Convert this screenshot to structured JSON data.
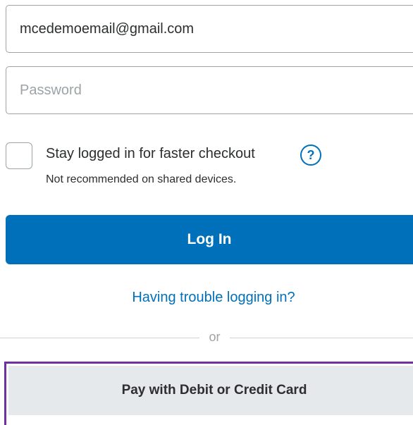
{
  "login_form": {
    "email_value": "mcedemoemail@gmail.com",
    "password_placeholder": "Password",
    "stay_logged_in_label": "Stay logged in for faster checkout",
    "stay_logged_in_checked": false,
    "help_icon_glyph": "?",
    "stay_logged_in_note": "Not recommended on shared devices.",
    "login_button_label": "Log In",
    "trouble_link_label": "Having trouble logging in?",
    "divider_text": "or",
    "card_button_label": "Pay with Debit or Credit Card"
  },
  "colors": {
    "primary_blue": "#0070ba",
    "highlight_outline": "#7030a0",
    "secondary_button_bg": "#e6e9ec"
  }
}
